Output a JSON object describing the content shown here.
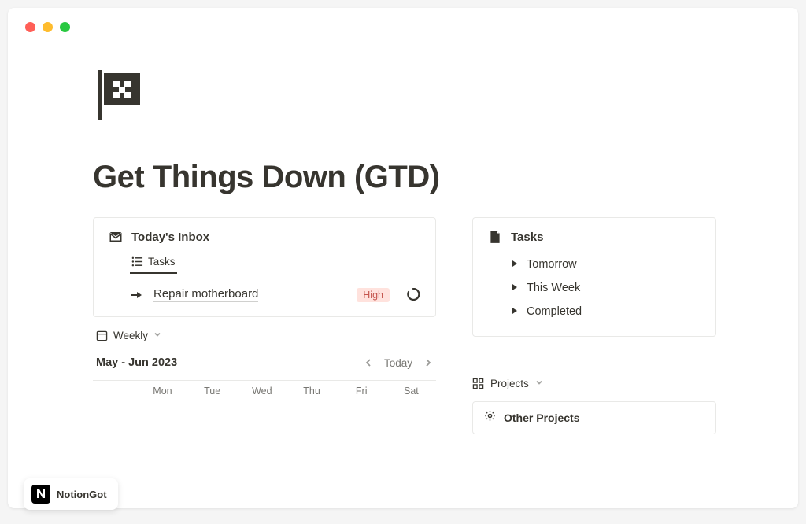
{
  "page": {
    "title": "Get Things Down (GTD)"
  },
  "inbox": {
    "title": "Today's Inbox",
    "tab_label": "Tasks",
    "task": {
      "name": "Repair motherboard",
      "priority": "High"
    }
  },
  "tasks_card": {
    "title": "Tasks",
    "items": [
      "Tomorrow",
      "This Week",
      "Completed"
    ]
  },
  "calendar": {
    "view_label": "Weekly",
    "range": "May - Jun 2023",
    "today_label": "Today",
    "weekdays": [
      "",
      "Mon",
      "Tue",
      "Wed",
      "Thu",
      "Fri",
      "Sat"
    ]
  },
  "projects": {
    "label": "Projects",
    "other": "Other Projects"
  },
  "badge": {
    "logo_letter": "N",
    "text": "NotionGot"
  }
}
